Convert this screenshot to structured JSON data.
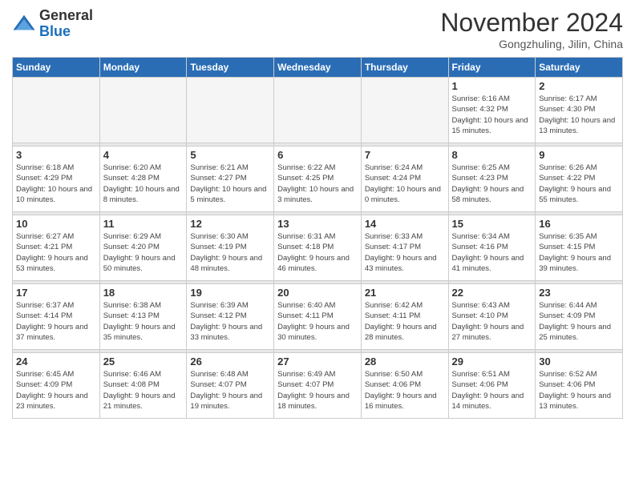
{
  "logo": {
    "general": "General",
    "blue": "Blue"
  },
  "title": "November 2024",
  "location": "Gongzhuling, Jilin, China",
  "days_header": [
    "Sunday",
    "Monday",
    "Tuesday",
    "Wednesday",
    "Thursday",
    "Friday",
    "Saturday"
  ],
  "weeks": [
    [
      {
        "day": "",
        "info": ""
      },
      {
        "day": "",
        "info": ""
      },
      {
        "day": "",
        "info": ""
      },
      {
        "day": "",
        "info": ""
      },
      {
        "day": "",
        "info": ""
      },
      {
        "day": "1",
        "info": "Sunrise: 6:16 AM\nSunset: 4:32 PM\nDaylight: 10 hours\nand 15 minutes."
      },
      {
        "day": "2",
        "info": "Sunrise: 6:17 AM\nSunset: 4:30 PM\nDaylight: 10 hours\nand 13 minutes."
      }
    ],
    [
      {
        "day": "3",
        "info": "Sunrise: 6:18 AM\nSunset: 4:29 PM\nDaylight: 10 hours\nand 10 minutes."
      },
      {
        "day": "4",
        "info": "Sunrise: 6:20 AM\nSunset: 4:28 PM\nDaylight: 10 hours\nand 8 minutes."
      },
      {
        "day": "5",
        "info": "Sunrise: 6:21 AM\nSunset: 4:27 PM\nDaylight: 10 hours\nand 5 minutes."
      },
      {
        "day": "6",
        "info": "Sunrise: 6:22 AM\nSunset: 4:25 PM\nDaylight: 10 hours\nand 3 minutes."
      },
      {
        "day": "7",
        "info": "Sunrise: 6:24 AM\nSunset: 4:24 PM\nDaylight: 10 hours\nand 0 minutes."
      },
      {
        "day": "8",
        "info": "Sunrise: 6:25 AM\nSunset: 4:23 PM\nDaylight: 9 hours\nand 58 minutes."
      },
      {
        "day": "9",
        "info": "Sunrise: 6:26 AM\nSunset: 4:22 PM\nDaylight: 9 hours\nand 55 minutes."
      }
    ],
    [
      {
        "day": "10",
        "info": "Sunrise: 6:27 AM\nSunset: 4:21 PM\nDaylight: 9 hours\nand 53 minutes."
      },
      {
        "day": "11",
        "info": "Sunrise: 6:29 AM\nSunset: 4:20 PM\nDaylight: 9 hours\nand 50 minutes."
      },
      {
        "day": "12",
        "info": "Sunrise: 6:30 AM\nSunset: 4:19 PM\nDaylight: 9 hours\nand 48 minutes."
      },
      {
        "day": "13",
        "info": "Sunrise: 6:31 AM\nSunset: 4:18 PM\nDaylight: 9 hours\nand 46 minutes."
      },
      {
        "day": "14",
        "info": "Sunrise: 6:33 AM\nSunset: 4:17 PM\nDaylight: 9 hours\nand 43 minutes."
      },
      {
        "day": "15",
        "info": "Sunrise: 6:34 AM\nSunset: 4:16 PM\nDaylight: 9 hours\nand 41 minutes."
      },
      {
        "day": "16",
        "info": "Sunrise: 6:35 AM\nSunset: 4:15 PM\nDaylight: 9 hours\nand 39 minutes."
      }
    ],
    [
      {
        "day": "17",
        "info": "Sunrise: 6:37 AM\nSunset: 4:14 PM\nDaylight: 9 hours\nand 37 minutes."
      },
      {
        "day": "18",
        "info": "Sunrise: 6:38 AM\nSunset: 4:13 PM\nDaylight: 9 hours\nand 35 minutes."
      },
      {
        "day": "19",
        "info": "Sunrise: 6:39 AM\nSunset: 4:12 PM\nDaylight: 9 hours\nand 33 minutes."
      },
      {
        "day": "20",
        "info": "Sunrise: 6:40 AM\nSunset: 4:11 PM\nDaylight: 9 hours\nand 30 minutes."
      },
      {
        "day": "21",
        "info": "Sunrise: 6:42 AM\nSunset: 4:11 PM\nDaylight: 9 hours\nand 28 minutes."
      },
      {
        "day": "22",
        "info": "Sunrise: 6:43 AM\nSunset: 4:10 PM\nDaylight: 9 hours\nand 27 minutes."
      },
      {
        "day": "23",
        "info": "Sunrise: 6:44 AM\nSunset: 4:09 PM\nDaylight: 9 hours\nand 25 minutes."
      }
    ],
    [
      {
        "day": "24",
        "info": "Sunrise: 6:45 AM\nSunset: 4:09 PM\nDaylight: 9 hours\nand 23 minutes."
      },
      {
        "day": "25",
        "info": "Sunrise: 6:46 AM\nSunset: 4:08 PM\nDaylight: 9 hours\nand 21 minutes."
      },
      {
        "day": "26",
        "info": "Sunrise: 6:48 AM\nSunset: 4:07 PM\nDaylight: 9 hours\nand 19 minutes."
      },
      {
        "day": "27",
        "info": "Sunrise: 6:49 AM\nSunset: 4:07 PM\nDaylight: 9 hours\nand 18 minutes."
      },
      {
        "day": "28",
        "info": "Sunrise: 6:50 AM\nSunset: 4:06 PM\nDaylight: 9 hours\nand 16 minutes."
      },
      {
        "day": "29",
        "info": "Sunrise: 6:51 AM\nSunset: 4:06 PM\nDaylight: 9 hours\nand 14 minutes."
      },
      {
        "day": "30",
        "info": "Sunrise: 6:52 AM\nSunset: 4:06 PM\nDaylight: 9 hours\nand 13 minutes."
      }
    ]
  ]
}
